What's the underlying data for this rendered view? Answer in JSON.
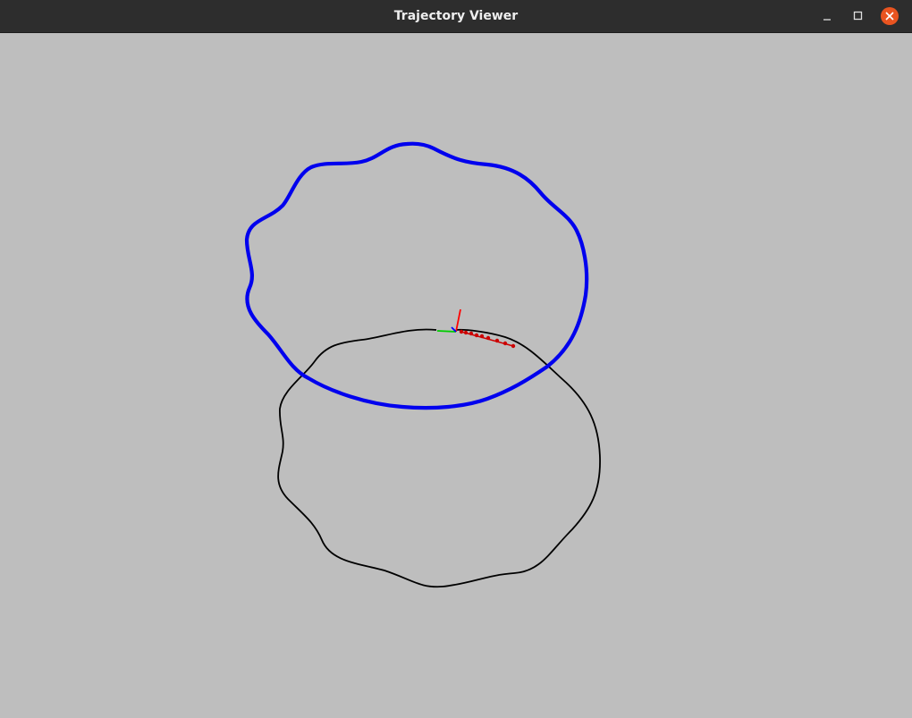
{
  "window": {
    "title": "Trajectory Viewer",
    "controls": {
      "minimize_icon": "minimize-icon",
      "maximize_icon": "maximize-icon",
      "close_icon": "close-icon"
    },
    "close_color": "#e95420"
  },
  "viewport": {
    "background": "#bebebe",
    "reference_path_color": "#000000",
    "estimated_path_color": "#0000ee",
    "pose_axes_colors": {
      "x": "#ff0000",
      "y": "#00cc00",
      "z": "#0000ff"
    },
    "marker_color": "#cc0000"
  }
}
